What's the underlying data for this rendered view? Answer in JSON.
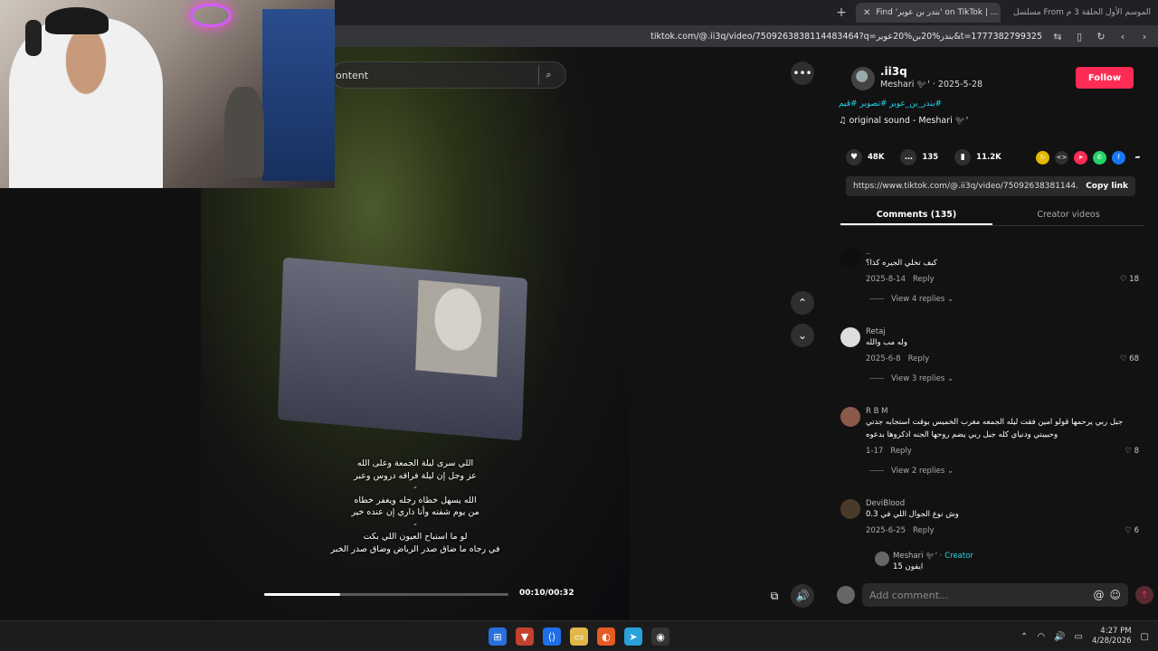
{
  "browser": {
    "tabs": [
      {
        "label": "مسلسل From الموسم الأول الحلقة 3 م...",
        "active": false
      },
      {
        "label": "Find 'بندر بن عوير' on TikTok | ...",
        "active": true
      }
    ],
    "url": "tiktok.com/@.ii3q/video/7509263838114483464?q=بندر%20بن%20عوير&t=1777382799325"
  },
  "video": {
    "search_placeholder": "ontent",
    "caption_lines": [
      "اللي سرى ليلة الجمعة وعلى الله",
      "عز وجل إن ليلة فراقه دروس وعبر",
      "-",
      "الله يسهل خطاه رجله ويغفر خطاه",
      "من يوم شفته وأنا داري إن عنده خير",
      "-",
      "لو ما استباح العيون اللي بكت",
      "في رجاه ما ضاق صدر الرياض وضاق صدر الخبر"
    ],
    "time": "00:10/00:32",
    "progress": 0.3125
  },
  "author": {
    "username": ".ii3q",
    "meta": "Meshari 🐦‍⬛' · 2025-5-28",
    "follow_label": "Follow",
    "tags": "#بندر_بن_عوير #تصوير #قيم",
    "sound": "original sound - Meshari 🐦‍⬛'"
  },
  "stats": {
    "likes": "48K",
    "comments": "135",
    "saves": "11.2K"
  },
  "share": {
    "link": "https://www.tiktok.com/@.ii3q/video/75092638381144...",
    "copy_label": "Copy link"
  },
  "tabs": {
    "comments": "Comments (135)",
    "creator": "Creator videos"
  },
  "comments": [
    {
      "name": "..",
      "text": "كيف تخلي الجيره كذا؟",
      "date": "2025-8-14",
      "reply": "Reply",
      "likes": "18",
      "views": "View 4 replies"
    },
    {
      "name": "Retaj",
      "text": "وله مب والله",
      "date": "2025-6-8",
      "reply": "Reply",
      "likes": "68",
      "views": "View 3 replies"
    },
    {
      "name": "R B M",
      "text": "جبل ربي يرحمها قولو امين فقت ليله الجمعه مغرب الخميس بوقت استجابه جدتي",
      "text2": "وحبيبتي ودنياي كله جبل ربي يضم روحها الجنه اذكروها بدعوه",
      "date": "1-17",
      "reply": "Reply",
      "likes": "8",
      "views": "View 2 replies"
    },
    {
      "name": "DeviBlood",
      "text": "وش نوع الجوال اللي في 0.3",
      "date": "2025-6-25",
      "reply": "Reply",
      "likes": "6"
    },
    {
      "name": "Meshari 🐦‍⬛' ·",
      "creator": "Creator",
      "text": "ايفون 15"
    }
  ],
  "add_comment": {
    "placeholder": "Add comment..."
  },
  "taskbar": {
    "time": "4:27 PM",
    "date": "4/28/2026"
  }
}
